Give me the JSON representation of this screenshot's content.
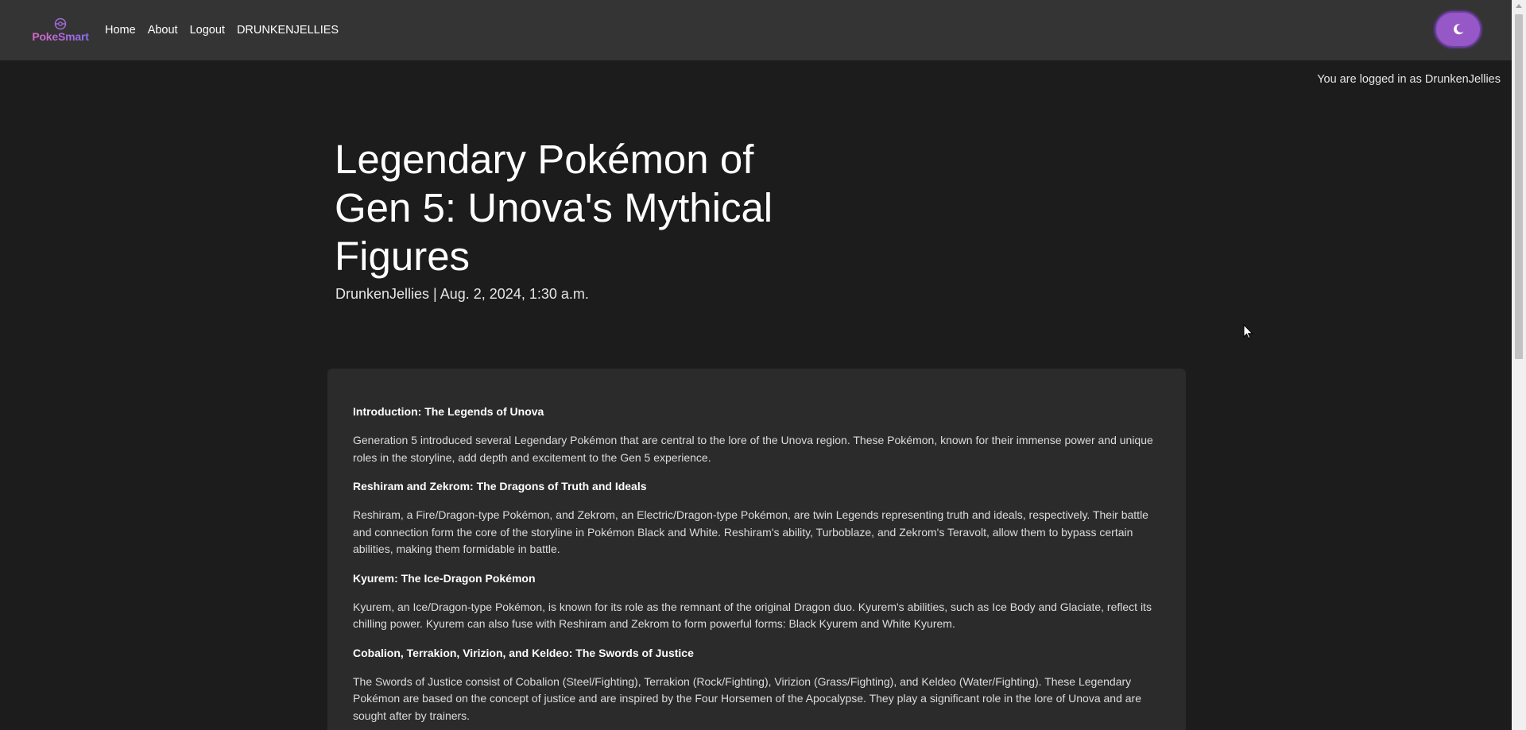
{
  "brand": {
    "name": "PokeSmart"
  },
  "nav": {
    "links": [
      "Home",
      "About",
      "Logout",
      "DRUNKENJELLIES"
    ]
  },
  "theme_toggle": {
    "icon": "moon-icon"
  },
  "session": {
    "logged_in_text": "You are logged in as DrunkenJellies"
  },
  "post": {
    "title": "Legendary Pokémon of Gen 5: Unova's Mythical Figures",
    "meta": "DrunkenJellies | Aug. 2, 2024, 1:30 a.m.",
    "sections": [
      {
        "heading": "Introduction: The Legends of Unova",
        "body": "Generation 5 introduced several Legendary Pokémon that are central to the lore of the Unova region. These Pokémon, known for their immense power and unique roles in the storyline, add depth and excitement to the Gen 5 experience."
      },
      {
        "heading": "Reshiram and Zekrom: The Dragons of Truth and Ideals",
        "body": "Reshiram, a Fire/Dragon-type Pokémon, and Zekrom, an Electric/Dragon-type Pokémon, are twin Legends representing truth and ideals, respectively. Their battle and connection form the core of the storyline in Pokémon Black and White. Reshiram's ability, Turboblaze, and Zekrom's Teravolt, allow them to bypass certain abilities, making them formidable in battle."
      },
      {
        "heading": "Kyurem: The Ice-Dragon Pokémon",
        "body": "Kyurem, an Ice/Dragon-type Pokémon, is known for its role as the remnant of the original Dragon duo. Kyurem's abilities, such as Ice Body and Glaciate, reflect its chilling power. Kyurem can also fuse with Reshiram and Zekrom to form powerful forms: Black Kyurem and White Kyurem."
      },
      {
        "heading": "Cobalion, Terrakion, Virizion, and Keldeo: The Swords of Justice",
        "body": "The Swords of Justice consist of Cobalion (Steel/Fighting), Terrakion (Rock/Fighting), Virizion (Grass/Fighting), and Keldeo (Water/Fighting). These Legendary Pokémon are based on the concept of justice and are inspired by the Four Horsemen of the Apocalypse. They play a significant role in the lore of Unova and are sought after by trainers."
      }
    ]
  },
  "colors": {
    "page_bg": "#1c1c1c",
    "navbar_bg": "#343434",
    "card_bg": "#2b2b2b",
    "toggle_bg": "#9658c6"
  }
}
